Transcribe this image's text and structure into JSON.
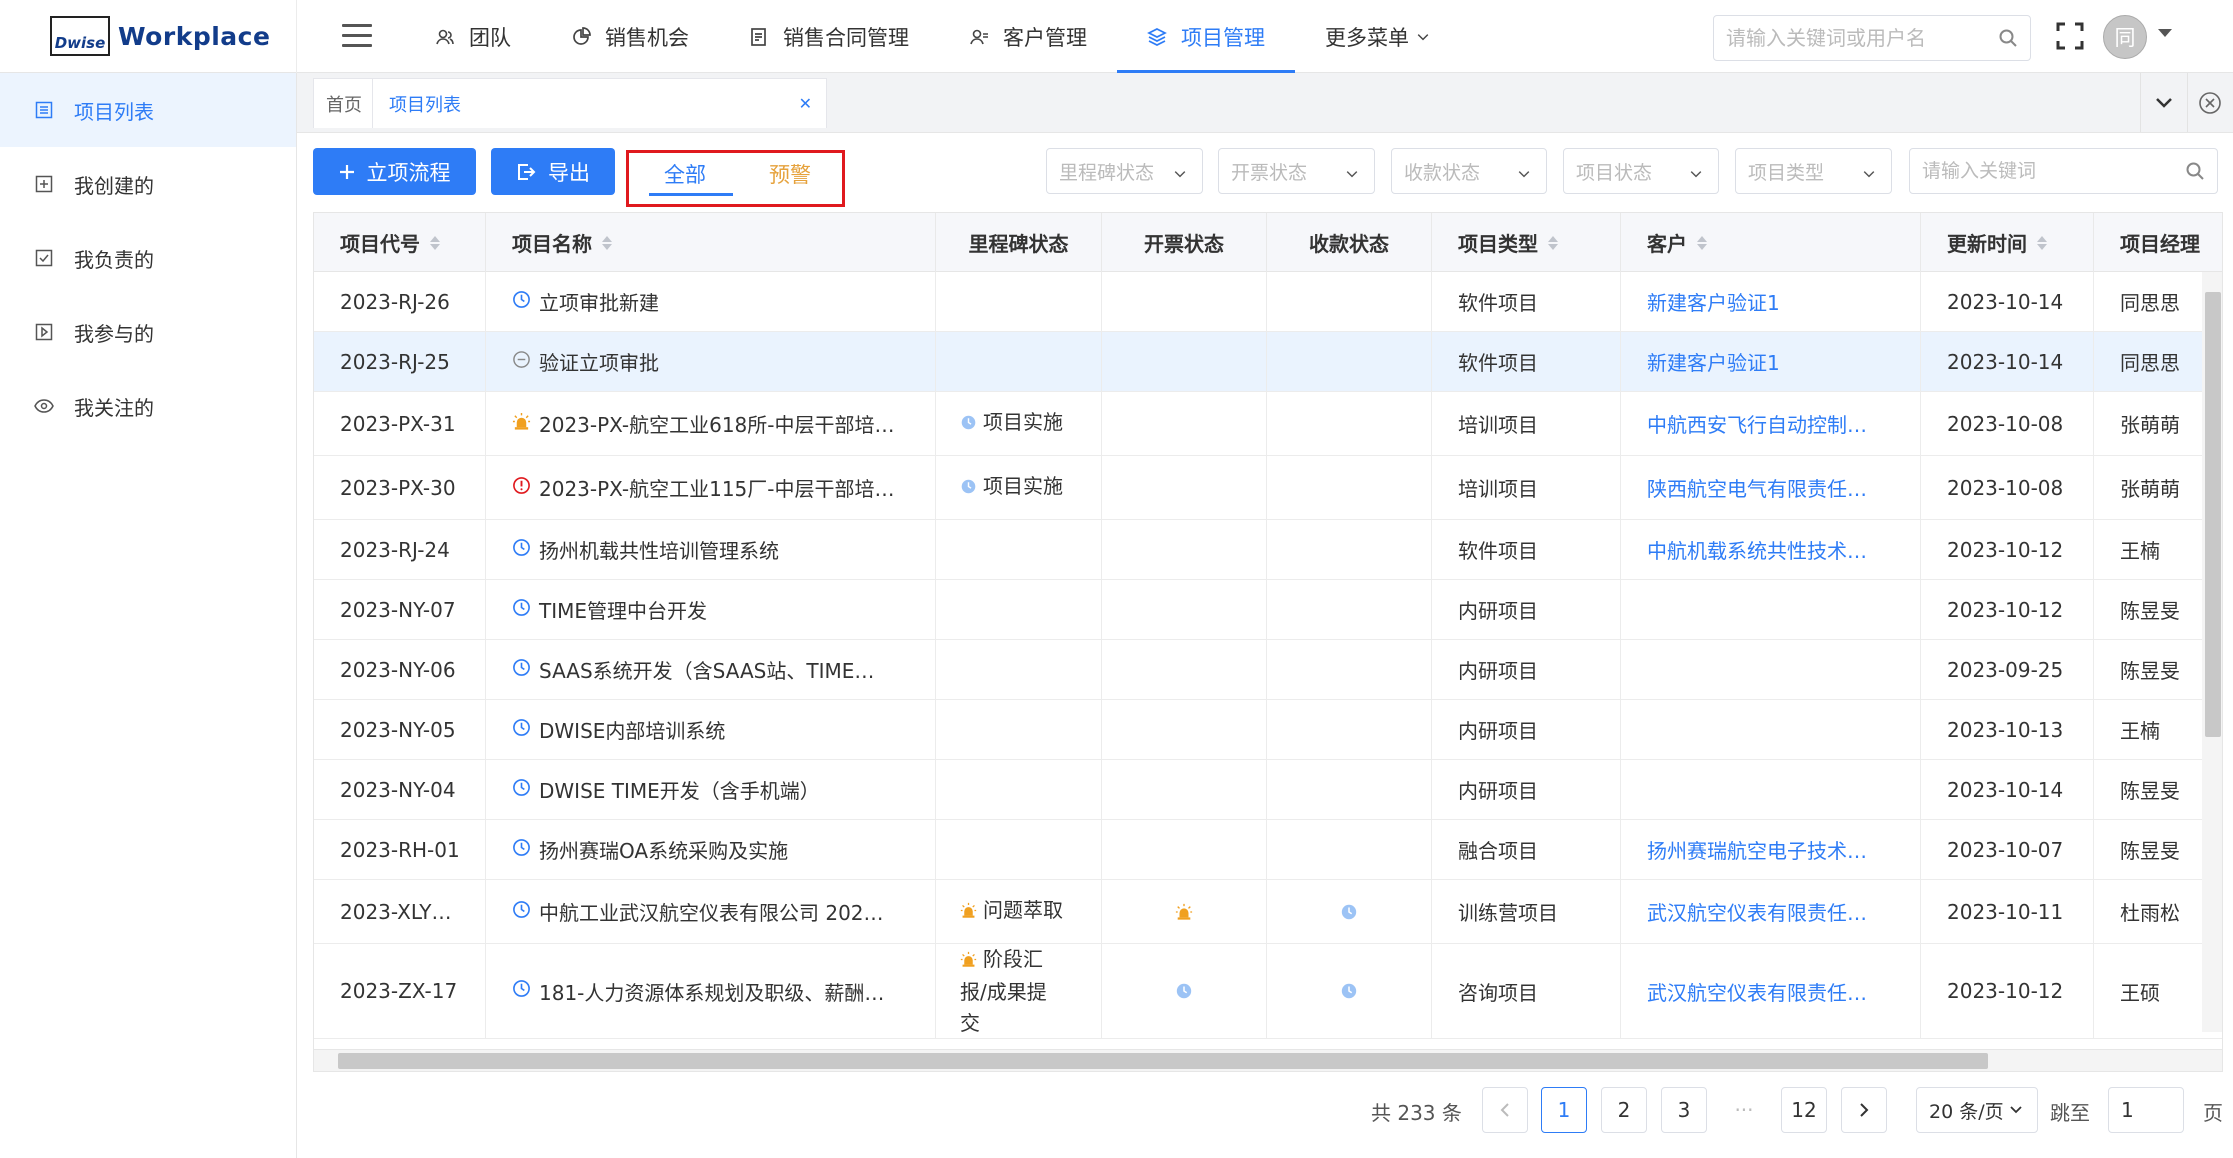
{
  "brand": {
    "logo_mark": "Dwise",
    "name": "Workplace"
  },
  "nav": [
    {
      "label": "团队",
      "icon": "team-icon",
      "active": false
    },
    {
      "label": "销售机会",
      "icon": "pie-chart-icon",
      "active": false
    },
    {
      "label": "销售合同管理",
      "icon": "contract-icon",
      "active": false
    },
    {
      "label": "客户管理",
      "icon": "customer-icon",
      "active": false
    },
    {
      "label": "项目管理",
      "icon": "layers-icon",
      "active": true
    },
    {
      "label": "更多菜单",
      "icon": "chevron-down-icon",
      "active": false
    }
  ],
  "top_search": {
    "placeholder": "请输入关键词或用户名"
  },
  "user": {
    "avatar_text": "同"
  },
  "sidebar": [
    {
      "label": "项目列表",
      "icon": "list-icon",
      "active": true
    },
    {
      "label": "我创建的",
      "icon": "plus-square-icon",
      "active": false
    },
    {
      "label": "我负责的",
      "icon": "check-square-icon",
      "active": false
    },
    {
      "label": "我参与的",
      "icon": "play-square-icon",
      "active": false
    },
    {
      "label": "我关注的",
      "icon": "eye-icon",
      "active": false
    }
  ],
  "tabs": {
    "home": "首页",
    "current": "项目列表"
  },
  "toolbar": {
    "create_label": "立项流程",
    "export_label": "导出",
    "seg_all": "全部",
    "seg_warn": "预警",
    "filters": [
      "里程碑状态",
      "开票状态",
      "收款状态",
      "项目状态",
      "项目类型"
    ],
    "keyword_placeholder": "请输入关键词"
  },
  "table": {
    "columns": [
      "项目代号",
      "项目名称",
      "里程碑状态",
      "开票状态",
      "收款状态",
      "项目类型",
      "客户",
      "更新时间",
      "项目经理"
    ],
    "rows": [
      {
        "code": "2023-RJ-26",
        "status_icon": "clock-icon",
        "name": "立项审批新建",
        "milestone": "",
        "milestone_icon": "",
        "invoice_icon": "",
        "payment_icon": "",
        "type": "软件项目",
        "customer": "新建客户验证1",
        "updated": "2023-10-14",
        "manager": "同思思"
      },
      {
        "code": "2023-RJ-25",
        "status_icon": "minus-circle-icon",
        "name": "验证立项审批",
        "milestone": "",
        "milestone_icon": "",
        "invoice_icon": "",
        "payment_icon": "",
        "type": "软件项目",
        "customer": "新建客户验证1",
        "updated": "2023-10-14",
        "manager": "同思思"
      },
      {
        "code": "2023-PX-31",
        "status_icon": "alarm-icon",
        "name": "2023-PX-航空工业618所-中层干部培…",
        "milestone": "项目实施",
        "milestone_icon": "clock-filled-icon",
        "invoice_icon": "",
        "payment_icon": "",
        "type": "培训项目",
        "customer": "中航西安飞行自动控制…",
        "updated": "2023-10-08",
        "manager": "张萌萌"
      },
      {
        "code": "2023-PX-30",
        "status_icon": "alert-circle-icon",
        "name": "2023-PX-航空工业115厂-中层干部培…",
        "milestone": "项目实施",
        "milestone_icon": "clock-filled-icon",
        "invoice_icon": "",
        "payment_icon": "",
        "type": "培训项目",
        "customer": "陕西航空电气有限责任…",
        "updated": "2023-10-08",
        "manager": "张萌萌"
      },
      {
        "code": "2023-RJ-24",
        "status_icon": "clock-icon",
        "name": "扬州机载共性培训管理系统",
        "milestone": "",
        "milestone_icon": "",
        "invoice_icon": "",
        "payment_icon": "",
        "type": "软件项目",
        "customer": "中航机载系统共性技术…",
        "updated": "2023-10-12",
        "manager": "王楠"
      },
      {
        "code": "2023-NY-07",
        "status_icon": "clock-icon",
        "name": "TIME管理中台开发",
        "milestone": "",
        "milestone_icon": "",
        "invoice_icon": "",
        "payment_icon": "",
        "type": "内研项目",
        "customer": "",
        "updated": "2023-10-12",
        "manager": "陈昱旻"
      },
      {
        "code": "2023-NY-06",
        "status_icon": "clock-icon",
        "name": "SAAS系统开发（含SAAS站、TIME…",
        "milestone": "",
        "milestone_icon": "",
        "invoice_icon": "",
        "payment_icon": "",
        "type": "内研项目",
        "customer": "",
        "updated": "2023-09-25",
        "manager": "陈昱旻"
      },
      {
        "code": "2023-NY-05",
        "status_icon": "clock-icon",
        "name": "DWISE内部培训系统",
        "milestone": "",
        "milestone_icon": "",
        "invoice_icon": "",
        "payment_icon": "",
        "type": "内研项目",
        "customer": "",
        "updated": "2023-10-13",
        "manager": "王楠"
      },
      {
        "code": "2023-NY-04",
        "status_icon": "clock-icon",
        "name": "DWISE TIME开发（含手机端）",
        "milestone": "",
        "milestone_icon": "",
        "invoice_icon": "",
        "payment_icon": "",
        "type": "内研项目",
        "customer": "",
        "updated": "2023-10-14",
        "manager": "陈昱旻"
      },
      {
        "code": "2023-RH-01",
        "status_icon": "clock-icon",
        "name": "扬州赛瑞OA系统采购及实施",
        "milestone": "",
        "milestone_icon": "",
        "invoice_icon": "",
        "payment_icon": "",
        "type": "融合项目",
        "customer": "扬州赛瑞航空电子技术…",
        "updated": "2023-10-07",
        "manager": "陈昱旻"
      },
      {
        "code": "2023-XLY…",
        "status_icon": "clock-icon",
        "name": "中航工业武汉航空仪表有限公司 202…",
        "milestone": "问题萃取",
        "milestone_icon": "alarm-icon",
        "invoice_icon": "alarm-icon",
        "payment_icon": "clock-filled-icon",
        "type": "训练营项目",
        "customer": "武汉航空仪表有限责任…",
        "updated": "2023-10-11",
        "manager": "杜雨松"
      },
      {
        "code": "2023-ZX-17",
        "status_icon": "clock-icon",
        "name": "181-人力资源体系规划及职级、薪酬…",
        "milestone": "阶段汇报/成果提交",
        "milestone_icon": "alarm-icon",
        "invoice_icon": "clock-filled-icon",
        "payment_icon": "clock-filled-icon",
        "type": "咨询项目",
        "customer": "武汉航空仪表有限责任…",
        "updated": "2023-10-12",
        "manager": "王硕"
      }
    ]
  },
  "pagination": {
    "total_text": "共 233 条",
    "pages": [
      "1",
      "2",
      "3",
      "···",
      "12"
    ],
    "current": "1",
    "page_size": "20 条/页",
    "jump_label": "跳至",
    "jump_value": "1",
    "page_unit": "页"
  },
  "colors": {
    "primary": "#2e7cf6",
    "warning": "#e6a23c",
    "danger": "#e0191e",
    "highlight_row": "#eaf3fe"
  }
}
